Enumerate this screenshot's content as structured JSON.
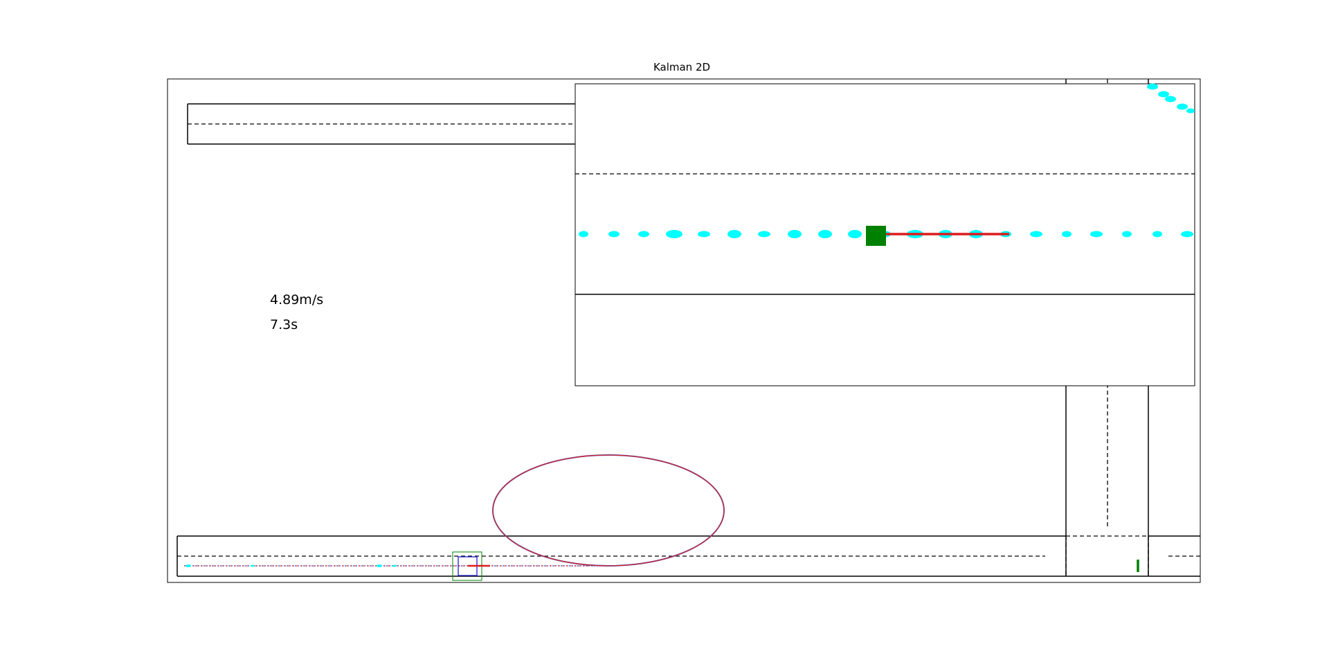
{
  "chart_data": {
    "type": "scatter",
    "title": "Kalman 2D",
    "annotations": {
      "speed": "4.89m/s",
      "time": "7.3s"
    },
    "series": [
      {
        "role": "measurements",
        "color": "#00ffff"
      },
      {
        "role": "kalman-estimate",
        "color": "#0000ff"
      },
      {
        "role": "prediction",
        "color": "#dd1c1c"
      },
      {
        "role": "vehicle",
        "color": "#008000"
      }
    ],
    "grid": false
  },
  "colors": {
    "measurement": "#00ffff",
    "estimate": "#0000ff",
    "prediction": "#dd1c1c",
    "vehicle": "#008000",
    "road": "#000000"
  }
}
